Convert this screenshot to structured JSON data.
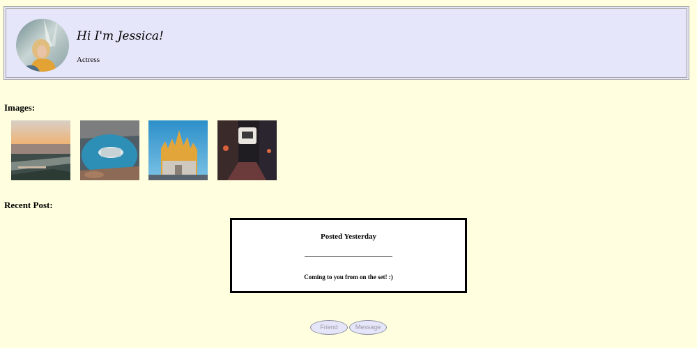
{
  "profile": {
    "greeting": "Hi I'm Jessica!",
    "role": "Actress",
    "avatar_icon": "profile-photo"
  },
  "images": {
    "label": "Images:",
    "items": [
      {
        "name": "beach-sunset-photo"
      },
      {
        "name": "puddle-reflection-photo"
      },
      {
        "name": "cathedral-photo"
      },
      {
        "name": "night-alley-photo"
      }
    ]
  },
  "recent_post": {
    "label": "Recent Post:",
    "title": "Posted Yesterday",
    "body": "Coming to you from on the set! :)"
  },
  "actions": {
    "friend_label": "Friend",
    "message_label": "Message"
  },
  "colors": {
    "page_background": "#ffffe0",
    "header_background": "#e6e6fa",
    "button_background": "#e6e6fa"
  }
}
